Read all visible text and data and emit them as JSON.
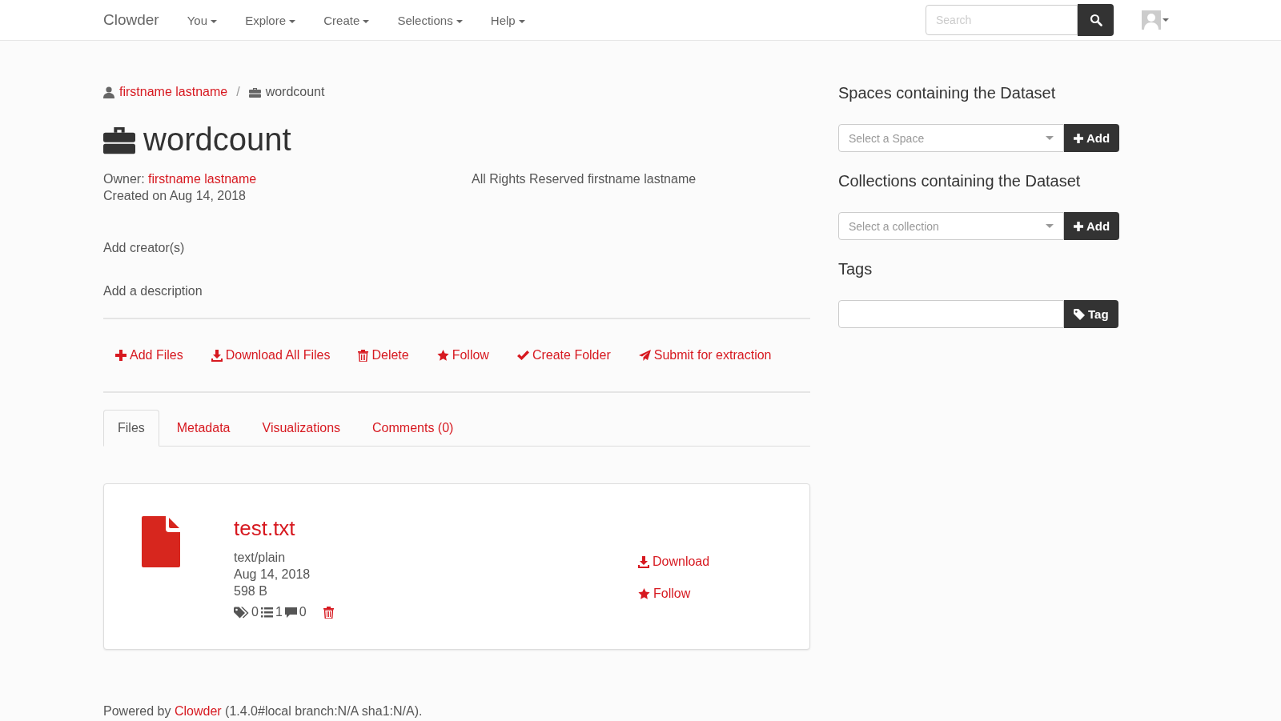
{
  "navbar": {
    "brand": "Clowder",
    "menus": [
      {
        "label": "You"
      },
      {
        "label": "Explore"
      },
      {
        "label": "Create"
      },
      {
        "label": "Selections"
      },
      {
        "label": "Help"
      }
    ],
    "search": {
      "placeholder": "Search"
    }
  },
  "breadcrumb_separator": "/",
  "breadcrumb": [
    {
      "kind": "user",
      "label": "firstname lastname",
      "link": true
    },
    {
      "kind": "dataset",
      "label": "wordcount",
      "link": false
    }
  ],
  "dataset": {
    "title": "wordcount",
    "owner_label": "Owner:",
    "owner": "firstname lastname",
    "created": "Created on Aug 14, 2018",
    "license": "All Rights Reserved firstname lastname",
    "add_creators": "Add creator(s)",
    "add_description": "Add a description"
  },
  "actions": [
    {
      "kind": "add",
      "label": "Add Files"
    },
    {
      "kind": "download",
      "label": "Download All Files"
    },
    {
      "kind": "delete",
      "label": "Delete"
    },
    {
      "kind": "follow",
      "label": "Follow"
    },
    {
      "kind": "check",
      "label": "Create Folder"
    },
    {
      "kind": "send",
      "label": "Submit for extraction"
    }
  ],
  "tabs": [
    {
      "label": "Files",
      "selected": true
    },
    {
      "label": "Metadata",
      "selected": false
    },
    {
      "label": "Visualizations",
      "selected": false
    },
    {
      "label": "Comments (0)",
      "selected": false
    }
  ],
  "files": [
    {
      "name": "test.txt",
      "type": "text/plain",
      "date": "Aug 14, 2018",
      "size": "598 B",
      "tags": "0",
      "metadata": "1",
      "comments": "0",
      "download": "Download",
      "follow": "Follow"
    }
  ],
  "sidebar": {
    "spaces": {
      "heading": "Spaces containing the Dataset",
      "placeholder": "Select a Space",
      "button": "Add"
    },
    "collections": {
      "heading": "Collections containing the Dataset",
      "placeholder": "Select a collection",
      "button": "Add"
    },
    "tags": {
      "heading": "Tags",
      "button": "Tag"
    }
  },
  "footer": {
    "prefix": "Powered by",
    "link": "Clowder",
    "suffix": "(1.4.0#local branch:N/A sha1:N/A)."
  }
}
